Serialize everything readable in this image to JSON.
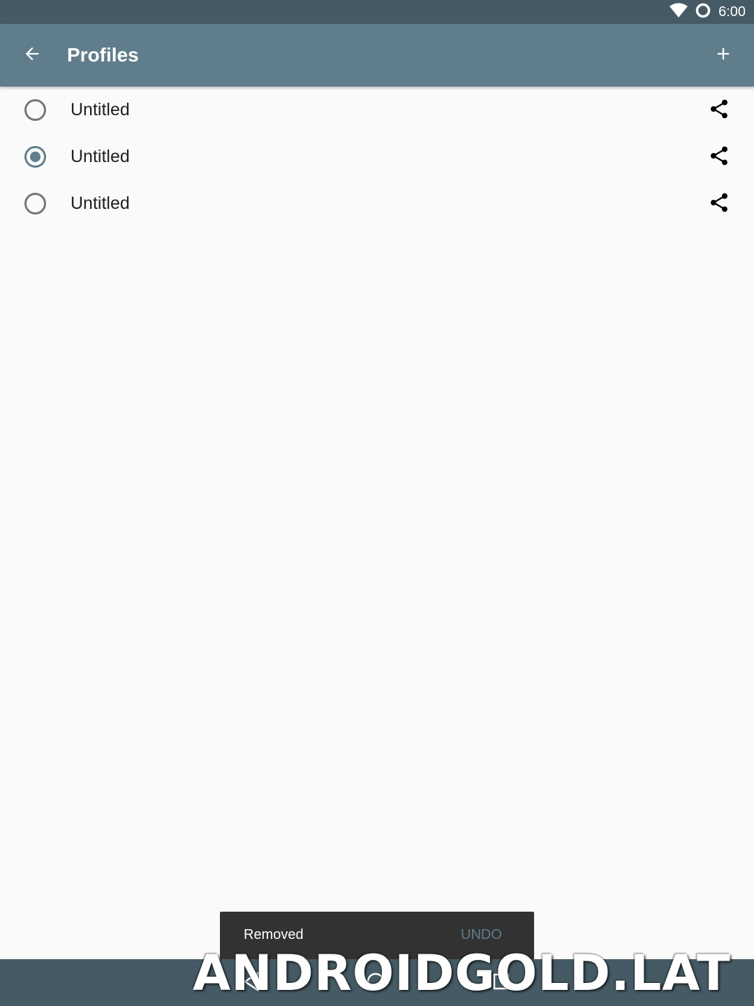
{
  "status_bar": {
    "time": "6:00",
    "icons": [
      "wifi-icon",
      "sync-icon"
    ]
  },
  "app_bar": {
    "title": "Profiles",
    "back_icon": "arrow-back-icon",
    "add_icon": "plus-icon"
  },
  "profiles": [
    {
      "label": "Untitled",
      "selected": false
    },
    {
      "label": "Untitled",
      "selected": true
    },
    {
      "label": "Untitled",
      "selected": false
    }
  ],
  "snackbar": {
    "message": "Removed",
    "action": "UNDO"
  },
  "nav_bar": {
    "icons": [
      "back-triangle-icon",
      "home-circle-icon",
      "recents-square-icon"
    ]
  },
  "watermark": "ANDROIDGOLD.LAT",
  "colors": {
    "primary": "#607d8b",
    "primary_dark": "#455a64",
    "background": "#fafafa",
    "snackbar": "#323232"
  }
}
